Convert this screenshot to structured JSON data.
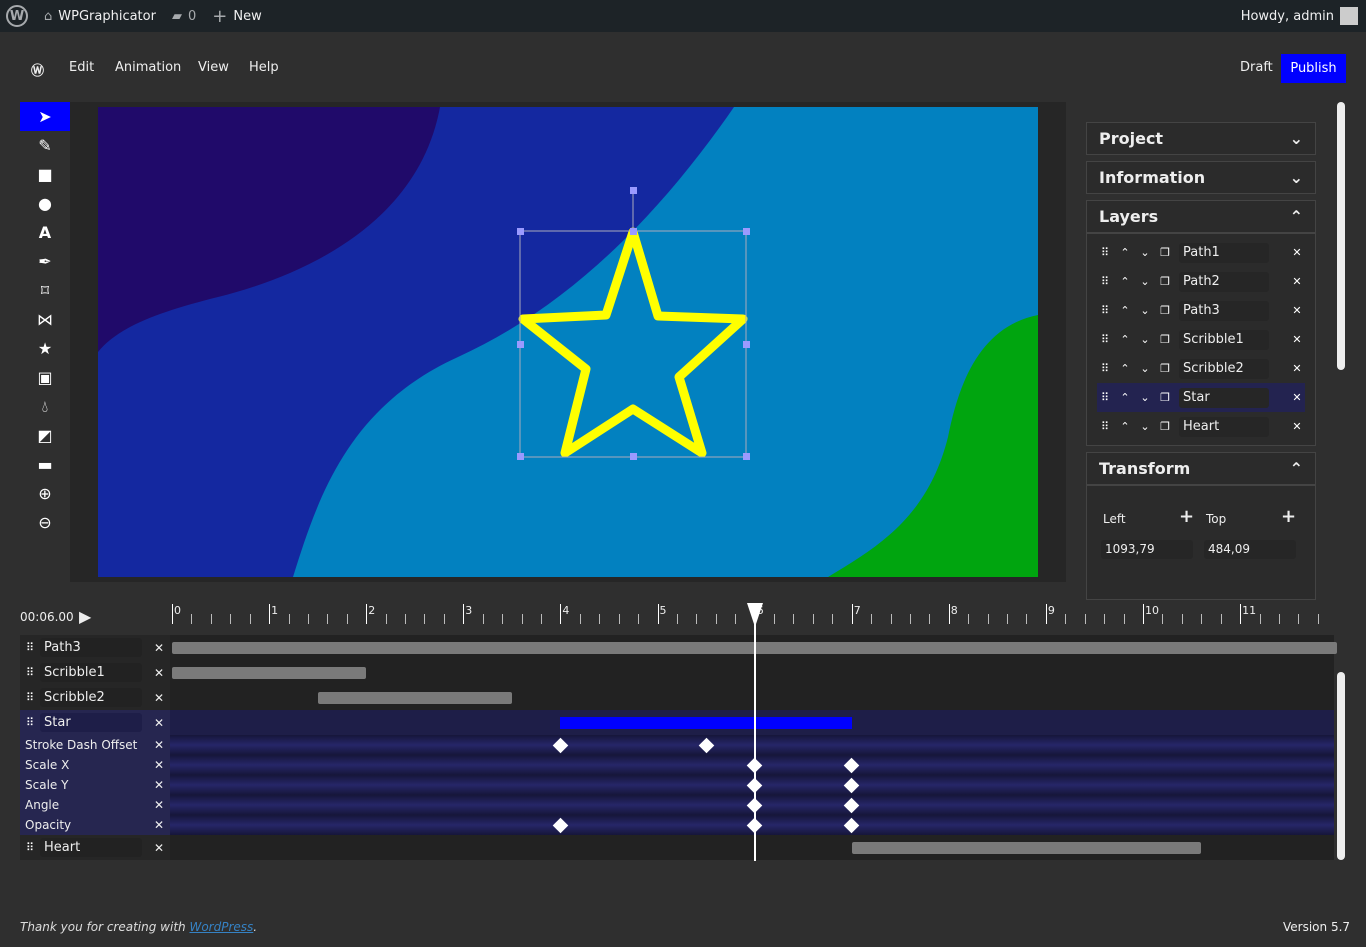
{
  "adminbar": {
    "site": "WPGraphicator",
    "comments": "0",
    "new": "New",
    "greeting": "Howdy, admin"
  },
  "menu": {
    "items": [
      "Edit",
      "Animation",
      "View",
      "Help"
    ],
    "draft": "Draft",
    "publish": "Publish"
  },
  "colors": {
    "accent": "#0000ff",
    "star_stroke": "#ffff00",
    "selected": "#232350"
  },
  "tools": [
    "select-icon",
    "pencil-icon",
    "rectangle-icon",
    "circle-icon",
    "text-icon",
    "pen-icon",
    "polygon-icon",
    "bezier-icon",
    "star-icon",
    "image-icon",
    "drop-icon",
    "paint-bucket-icon",
    "line-icon",
    "zoom-in-icon",
    "zoom-out-icon"
  ],
  "panel": {
    "project": "Project",
    "information": "Information",
    "layers_title": "Layers",
    "transform": "Transform",
    "layers": [
      {
        "name": "Path1"
      },
      {
        "name": "Path2"
      },
      {
        "name": "Path3"
      },
      {
        "name": "Scribble1"
      },
      {
        "name": "Scribble2"
      },
      {
        "name": "Star",
        "selected": true
      },
      {
        "name": "Heart"
      }
    ],
    "left_label": "Left",
    "top_label": "Top",
    "left_value": "1093,79",
    "top_value": "484,09"
  },
  "timeline": {
    "time": "00:06.00",
    "ruler_labels": [
      "0",
      "1",
      "2",
      "3",
      "4",
      "5",
      "6",
      "7",
      "8",
      "9",
      "10",
      "11"
    ],
    "playhead_seconds": 6,
    "rows": [
      {
        "name": "Path3",
        "type": "layer",
        "start": 0,
        "end": 12
      },
      {
        "name": "Scribble1",
        "type": "layer",
        "start": 0,
        "end": 2
      },
      {
        "name": "Scribble2",
        "type": "layer",
        "start": 1.5,
        "end": 3.5
      },
      {
        "name": "Star",
        "type": "layer",
        "start": 4,
        "end": 7,
        "selected": true
      },
      {
        "name": "Stroke Dash Offset",
        "type": "prop",
        "keyframes": [
          4,
          5.5
        ]
      },
      {
        "name": "Scale X",
        "type": "prop",
        "keyframes": [
          6,
          7
        ]
      },
      {
        "name": "Scale Y",
        "type": "prop",
        "keyframes": [
          6,
          7
        ]
      },
      {
        "name": "Angle",
        "type": "prop",
        "keyframes": [
          6,
          7
        ]
      },
      {
        "name": "Opacity",
        "type": "prop",
        "keyframes": [
          4,
          6,
          7
        ]
      },
      {
        "name": "Heart",
        "type": "layer",
        "start": 7,
        "end": 10.6
      }
    ]
  },
  "footer": {
    "thanks": "Thank you for creating with ",
    "link": "WordPress",
    "dot": ".",
    "version": "Version 5.7"
  }
}
